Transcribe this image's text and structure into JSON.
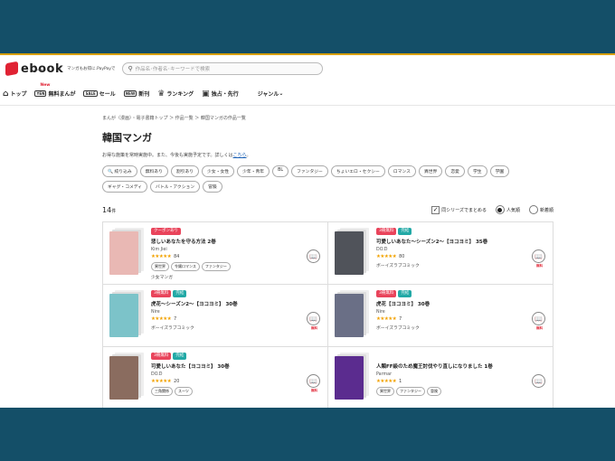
{
  "header": {
    "logo_text": "ebook",
    "logo_sub": "japan",
    "tagline": "マンガもお得に.PayPayで",
    "search_placeholder": "作品名･作者名･キーワードで検索"
  },
  "nav": {
    "items": [
      {
        "label": "トップ",
        "icon": "⌂"
      },
      {
        "label": "無料まんが",
        "icon": "YEN",
        "new": "New"
      },
      {
        "label": "セール",
        "icon": "SALE"
      },
      {
        "label": "新刊",
        "icon": "NEW"
      },
      {
        "label": "ランキング",
        "icon": "♛"
      },
      {
        "label": "独占・先行",
        "icon": "▣"
      }
    ],
    "genre_label": "ジャンル",
    "genre_chevron": "⌄"
  },
  "breadcrumb": "まんが（漫画）・電子書籍トップ ＞ 作品一覧 ＞ 韓国マンガの作品一覧",
  "page_title": "韓国マンガ",
  "notice": {
    "text": "お得な施策を常時実施中。また、今後も実施予定です。詳しくは",
    "link": "こちら",
    "end": "。"
  },
  "filters": [
    "🔍 絞り込み",
    "無料あり",
    "割引あり",
    "少女・女性",
    "少年・青年",
    "BL",
    "ファンタジー",
    "ちょいエロ・セクシー",
    "ロマンス",
    "異世界",
    "恋愛",
    "学生",
    "学園",
    "ギャグ・コメディ",
    "バトル・アクション",
    "冒険"
  ],
  "controls": {
    "count": "14",
    "count_unit": "件",
    "series_label": "同シリーズでまとめる",
    "sort_popular": "人気順",
    "sort_new": "新着順"
  },
  "items": [
    {
      "badges": [
        {
          "text": "クーポンあり",
          "color": "#e9445b"
        }
      ],
      "title": "悲しいあなたを守る方法 2巻",
      "author": "Kim Jiei",
      "rating": "84",
      "tags": [
        "異世界",
        "令嬢ロマンス",
        "ファンタジー"
      ],
      "publisher": "少女マンガ",
      "cover": "#e9b8b4",
      "free": ""
    },
    {
      "badges": [
        {
          "text": "3冊無料",
          "color": "#e9445b"
        },
        {
          "text": "完結",
          "color": "#22a9a6"
        }
      ],
      "title": "可愛しいあなた～シーズン2～【ヨコヨミ】 35巻",
      "author": "DO.D",
      "rating": "80",
      "tags": [],
      "publisher": "ボーイズラブコミック",
      "cover": "#50535a",
      "free": "無料"
    },
    {
      "badges": [
        {
          "text": "3冊無料",
          "color": "#e9445b"
        },
        {
          "text": "完結",
          "color": "#22a9a6"
        }
      ],
      "title": "虎花～シーズン2～【ヨコヨミ】 30巻",
      "author": "Nire",
      "rating": "7",
      "tags": [],
      "publisher": "ボーイズラブコミック",
      "cover": "#7cc3c9",
      "free": "無料"
    },
    {
      "badges": [
        {
          "text": "3冊無料",
          "color": "#e9445b"
        },
        {
          "text": "完結",
          "color": "#22a9a6"
        }
      ],
      "title": "虎花【ヨコヨミ】 30巻",
      "author": "Nire",
      "rating": "7",
      "tags": [],
      "publisher": "ボーイズラブコミック",
      "cover": "#6a6f86",
      "free": "無料"
    },
    {
      "badges": [
        {
          "text": "3冊無料",
          "color": "#e9445b"
        },
        {
          "text": "完結",
          "color": "#22a9a6"
        }
      ],
      "title": "可愛しいあなた【ヨコヨミ】 30巻",
      "author": "DO.D",
      "rating": "20",
      "tags": [
        "三角関係",
        "スーツ"
      ],
      "publisher": "",
      "cover": "#8a6c5f",
      "free": "無料"
    },
    {
      "badges": [],
      "title": "人類FF級のため魔王討伐やり直しになりました 1巻",
      "author": "Parmar",
      "rating": "1",
      "tags": [
        "異世界",
        "ファンタジー",
        "冒険"
      ],
      "publisher": "",
      "cover": "#5b2c8f",
      "free": ""
    }
  ]
}
